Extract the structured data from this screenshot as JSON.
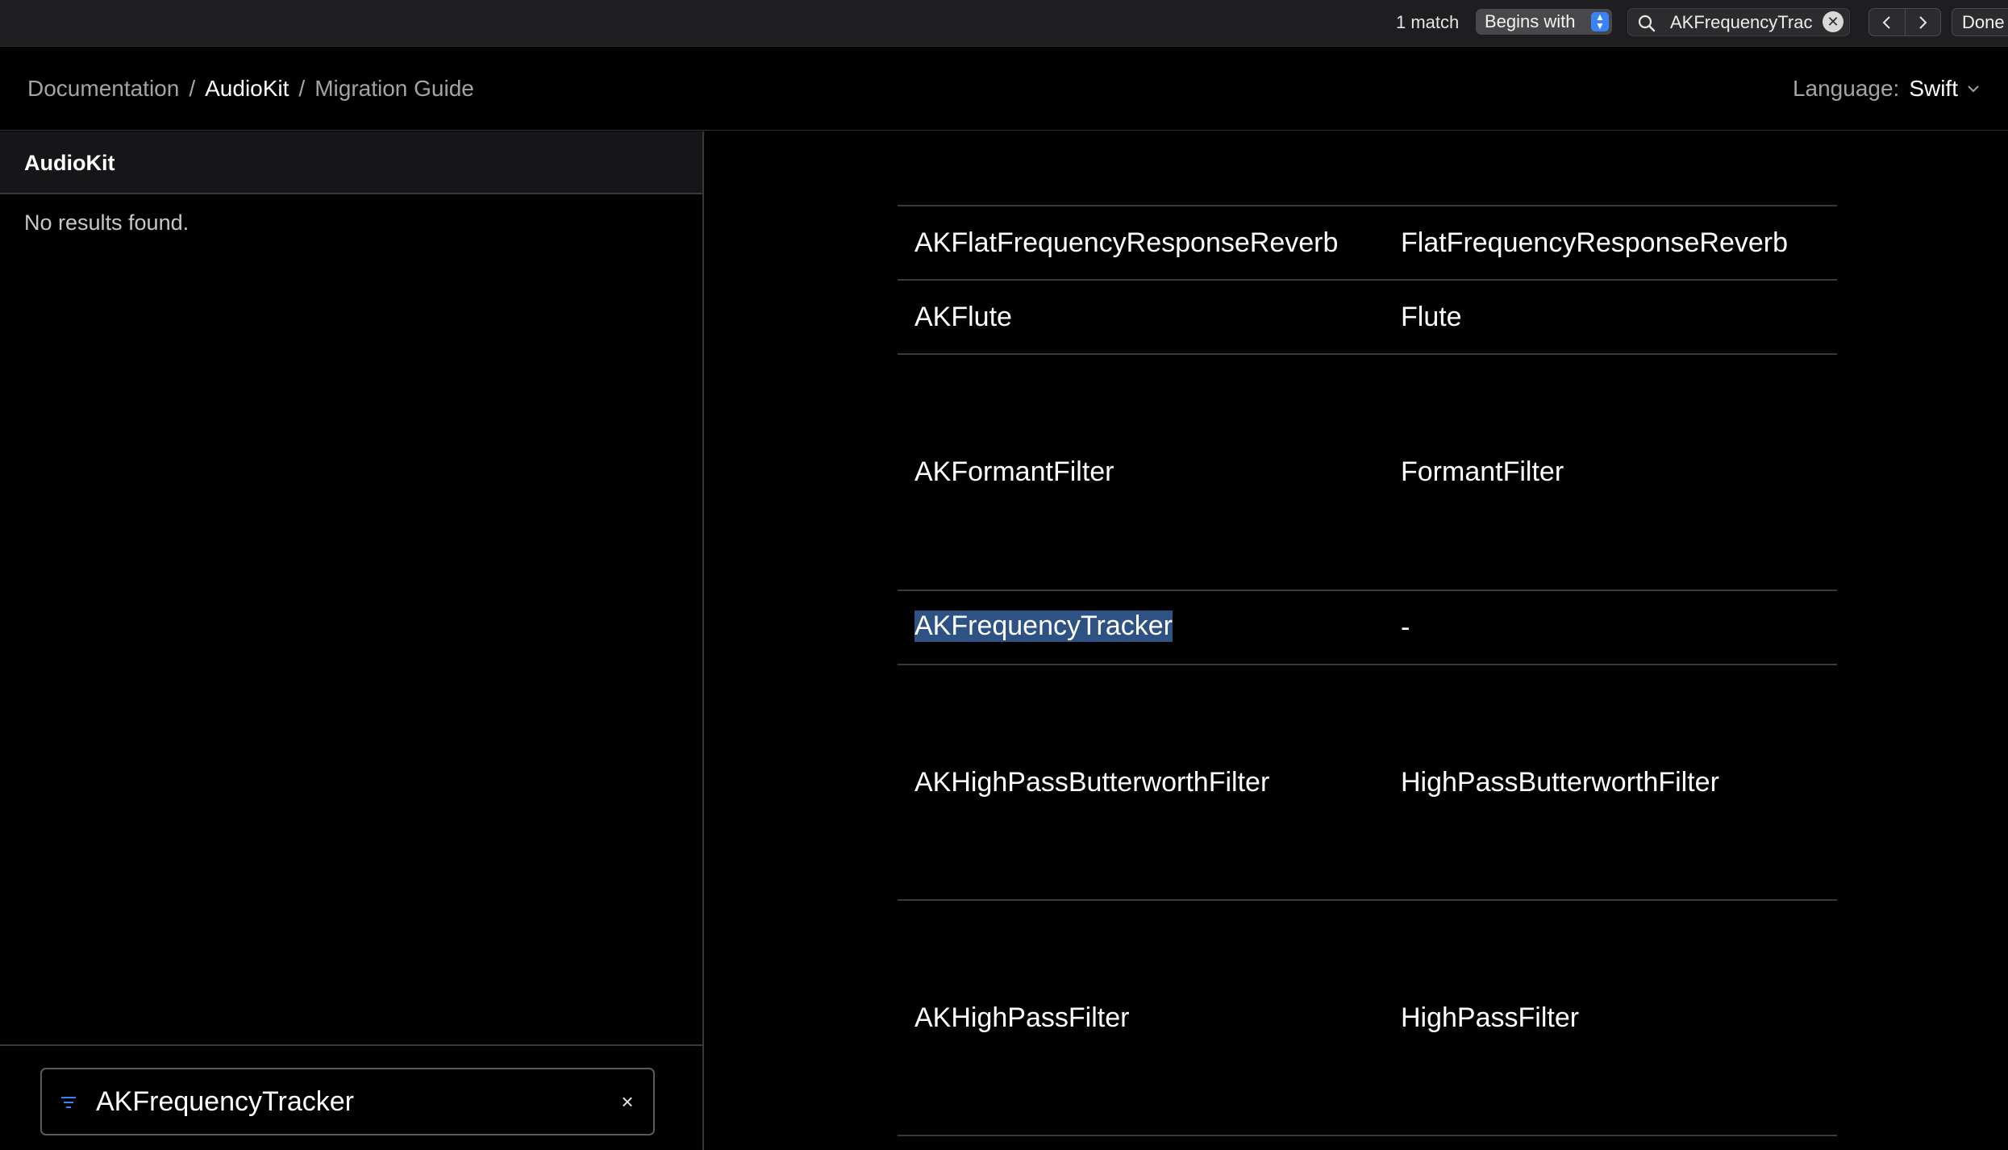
{
  "find_bar": {
    "match_count": "1 match",
    "mode": "Begins with",
    "query": "AKFrequencyTrac",
    "done_label": "Done"
  },
  "breadcrumb": {
    "items": [
      "Documentation",
      "AudioKit",
      "Migration Guide"
    ],
    "separator": "/"
  },
  "language": {
    "label": "Language:",
    "value": "Swift"
  },
  "sidebar": {
    "title": "AudioKit",
    "empty_message": "No results found.",
    "filter_value": "AKFrequencyTracker"
  },
  "table": {
    "rows": [
      {
        "old": "AKFlatFrequencyResponseReverb",
        "new": "FlatFrequencyResponseReverb"
      },
      {
        "old": "AKFlute",
        "new": "Flute"
      },
      {
        "old": "AKFormantFilter",
        "new": "FormantFilter"
      },
      {
        "old": "AKFrequencyTracker",
        "new": "-"
      },
      {
        "old": "AKHighPassButterworthFilter",
        "new": "HighPassButterworthFilter"
      },
      {
        "old": "AKHighPassFilter",
        "new": "HighPassFilter"
      }
    ]
  },
  "colors": {
    "highlight": "#2e5283",
    "accent": "#3a82f7"
  }
}
